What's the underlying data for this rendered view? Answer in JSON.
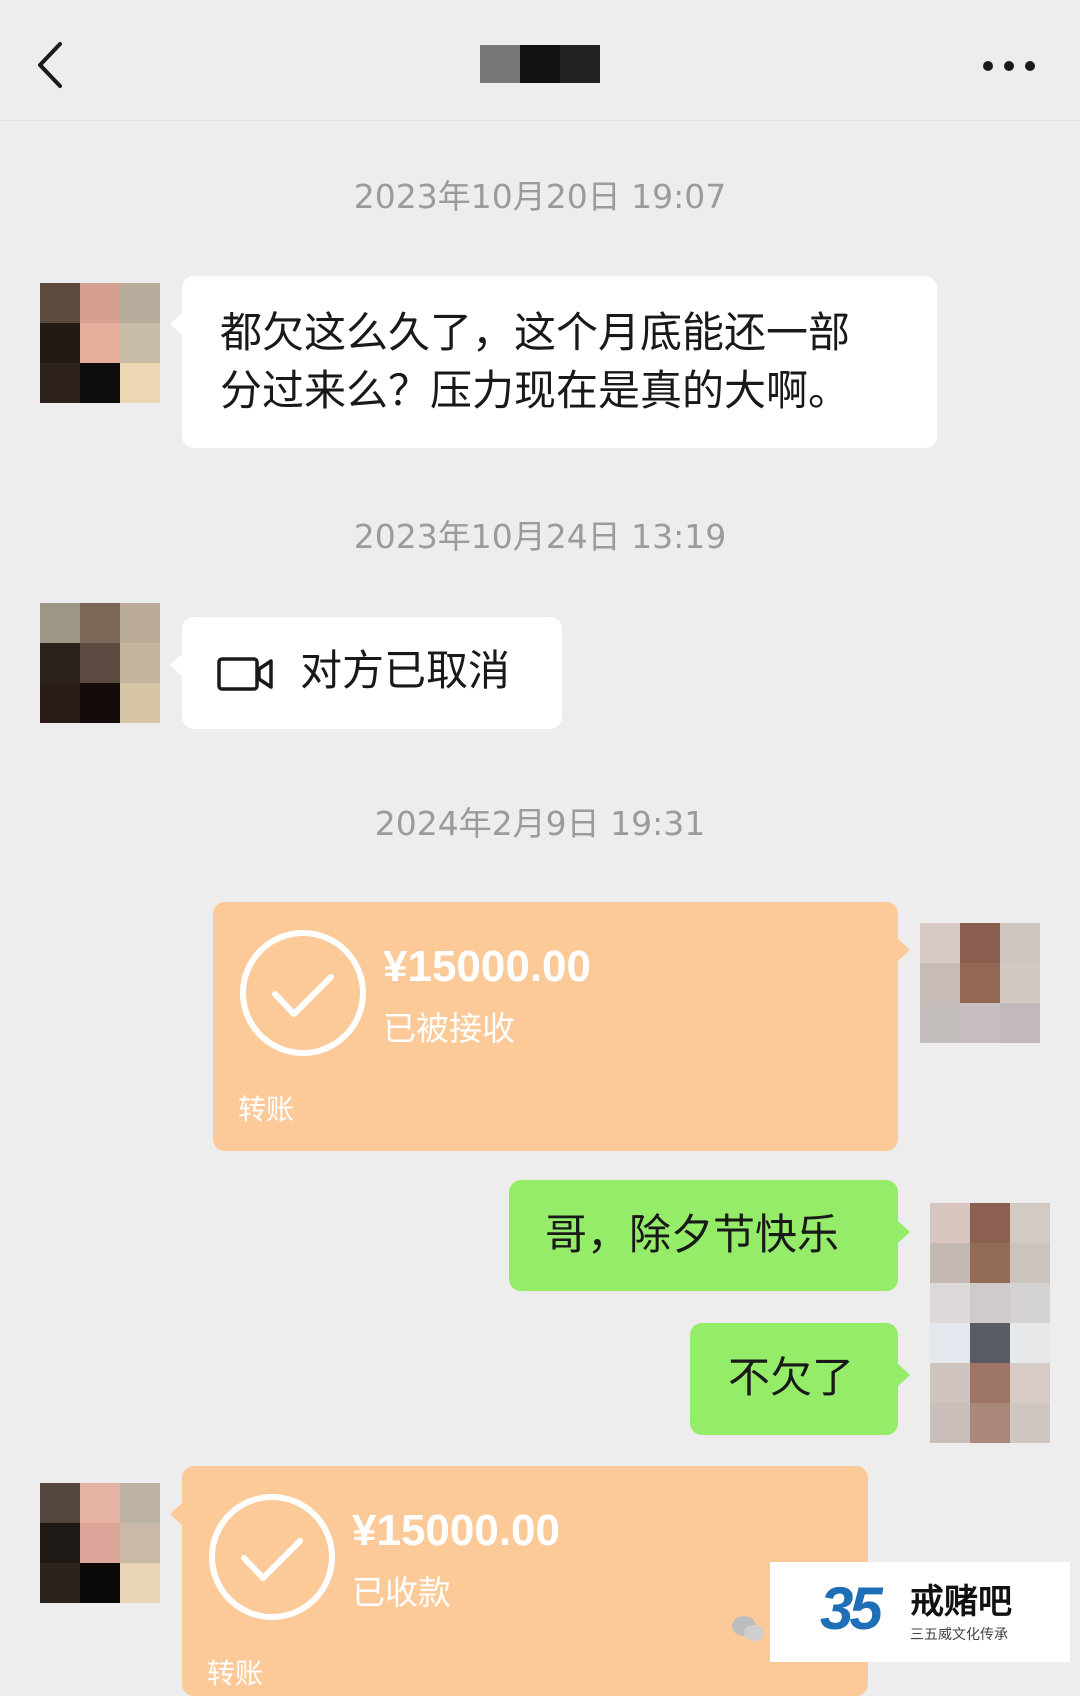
{
  "header": {
    "back_icon": "chevron-left-icon",
    "more_icon": "more-dots-icon"
  },
  "timestamps": [
    "2023年10月20日 19:07",
    "2023年10月24日 13:19",
    "2024年2月9日 19:31"
  ],
  "messages": {
    "m1_line1": "都欠这么久了，这个月底能还一部",
    "m1_line2": "分过来么？压力现在是真的大啊。",
    "m2_text": "对方已取消",
    "m2_icon": "video-call-icon",
    "m3_amount": "¥15000.00",
    "m3_status": "已被接收",
    "m3_label": "转账",
    "m4_text": "哥，除夕节快乐",
    "m5_text": "不欠了",
    "m6_amount": "¥15000.00",
    "m6_status": "已收款",
    "m6_label": "转账"
  },
  "watermark": {
    "number": "35",
    "name": "戒赌吧",
    "sub": "三五威文化传承"
  },
  "colors": {
    "background": "#ededed",
    "green_bubble": "#95ec69",
    "transfer_bubble": "#fcca99",
    "timestamp": "#9b9b9b"
  }
}
